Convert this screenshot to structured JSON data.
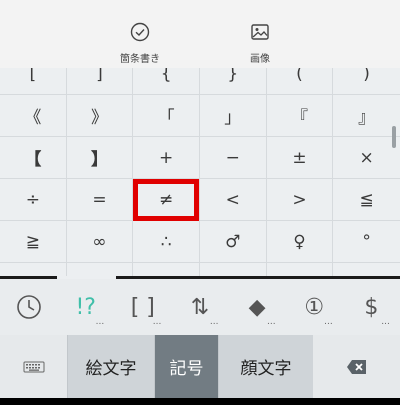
{
  "toolbar": {
    "items": [
      {
        "label": "箇条書き",
        "icon": "check-circle-icon"
      },
      {
        "label": "画像",
        "icon": "image-icon"
      }
    ]
  },
  "symbol_grid": {
    "rows": [
      [
        "[",
        "]",
        "{",
        "}",
        "(",
        ")"
      ],
      [
        "《",
        "》",
        "「",
        "」",
        "『",
        "』"
      ],
      [
        "【",
        "】",
        "+",
        "−",
        "±",
        "×"
      ],
      [
        "÷",
        "=",
        "≠",
        "<",
        ">",
        "≦"
      ],
      [
        "≧",
        "∞",
        "∴",
        "♂",
        "♀",
        "°"
      ],
      [
        "'",
        "\"",
        "℃",
        "¥",
        "$",
        "¢"
      ]
    ],
    "selected": "≠"
  },
  "categories": [
    {
      "symbol": "",
      "icon": "clock-icon",
      "name": "history"
    },
    {
      "symbol": "!?",
      "dots": "...",
      "name": "punctuation"
    },
    {
      "symbol": "[ ]",
      "dots": "...",
      "name": "brackets"
    },
    {
      "symbol": "⇅",
      "dots": "...",
      "name": "arrows"
    },
    {
      "symbol": "◆",
      "dots": "...",
      "name": "shapes"
    },
    {
      "symbol": "①",
      "dots": "...",
      "name": "numbers"
    },
    {
      "symbol": "$",
      "dots": "...",
      "name": "currency"
    }
  ],
  "bottom": {
    "tabs": [
      "絵文字",
      "記号",
      "顔文字"
    ],
    "active_tab": "記号"
  },
  "colors": {
    "accent": "#40bfa9",
    "selection": "#e00000",
    "active_tab_bg": "#727c83"
  }
}
